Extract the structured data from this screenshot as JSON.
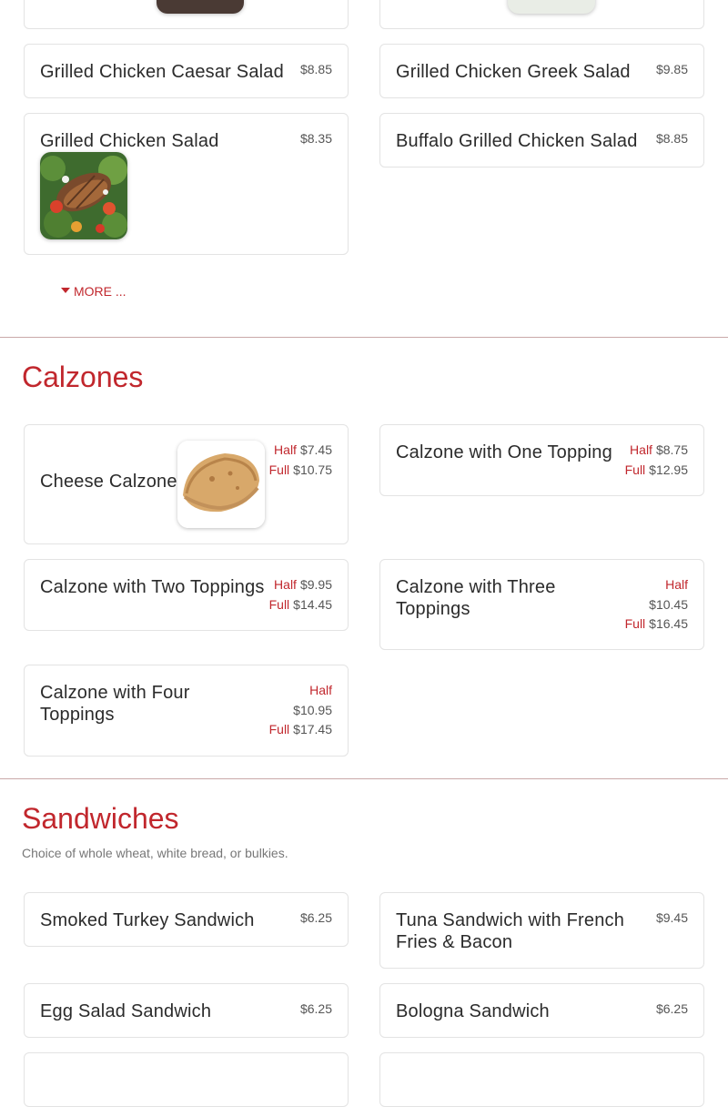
{
  "colors": {
    "accent": "#c1272d",
    "border": "#e3e3e3",
    "divider": "#c9a9a9"
  },
  "salads": {
    "items": [
      {
        "name": "Grilled Chicken Caesar Salad",
        "price": "$8.85"
      },
      {
        "name": "Grilled Chicken Greek Salad",
        "price": "$9.85"
      },
      {
        "name": "Grilled Chicken Salad",
        "price": "$8.35"
      },
      {
        "name": "Buffalo Grilled Chicken Salad",
        "price": "$8.85"
      }
    ],
    "more_label": "MORE ..."
  },
  "calzones": {
    "title": "Calzones",
    "half_label": "Half",
    "full_label": "Full",
    "items": [
      {
        "name": "Cheese Calzone",
        "half": "$7.45",
        "full": "$10.75"
      },
      {
        "name": "Calzone with One Topping",
        "half": "$8.75",
        "full": "$12.95"
      },
      {
        "name": "Calzone with Two Toppings",
        "half": "$9.95",
        "full": "$14.45"
      },
      {
        "name": "Calzone with Three Toppings",
        "half": "$10.45",
        "full": "$16.45"
      },
      {
        "name": "Calzone with Four Toppings",
        "half": "$10.95",
        "full": "$17.45"
      }
    ]
  },
  "sandwiches": {
    "title": "Sandwiches",
    "description": "Choice of whole wheat, white bread, or bulkies.",
    "items": [
      {
        "name": "Smoked Turkey Sandwich",
        "price": "$6.25"
      },
      {
        "name": "Tuna Sandwich with French Fries & Bacon",
        "price": "$9.45"
      },
      {
        "name": "Egg Salad Sandwich",
        "price": "$6.25"
      },
      {
        "name": "Bologna Sandwich",
        "price": "$6.25"
      }
    ]
  }
}
